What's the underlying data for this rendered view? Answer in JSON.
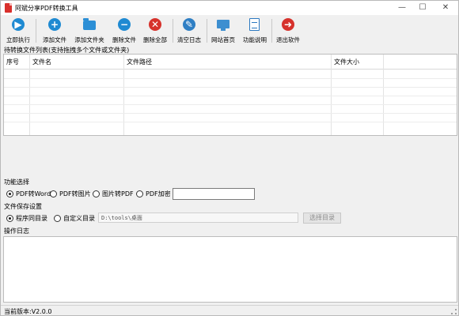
{
  "window": {
    "title": "阿斌分享PDF转换工具",
    "min_glyph": "—",
    "max_glyph": "☐",
    "close_glyph": "✕"
  },
  "toolbar": {
    "run": "立即执行",
    "add_file": "添加文件",
    "add_folder": "添加文件夹",
    "delete_file": "删除文件",
    "delete_all": "删除全部",
    "clear_log": "清空日志",
    "website": "网站首页",
    "help": "功能说明",
    "exit": "退出软件"
  },
  "file_list": {
    "title": "待转换文件列表(支持拖拽多个文件或文件夹)",
    "columns": [
      "序号",
      "文件名",
      "文件路径",
      "文件大小"
    ],
    "rows": []
  },
  "function": {
    "title": "功能选择",
    "options": [
      "PDF转Word",
      "PDF转图片",
      "图片转PDF",
      "PDF加密"
    ],
    "selected": "PDF转Word",
    "password_value": ""
  },
  "save": {
    "title": "文件保存设置",
    "options": [
      "程序同目录",
      "自定义目录"
    ],
    "selected": "程序同目录",
    "path_value": "D:\\tools\\桌面",
    "select_button": "选择目录"
  },
  "log": {
    "title": "操作日志",
    "content": ""
  },
  "status": {
    "version": "当前版本:V2.0.0"
  }
}
